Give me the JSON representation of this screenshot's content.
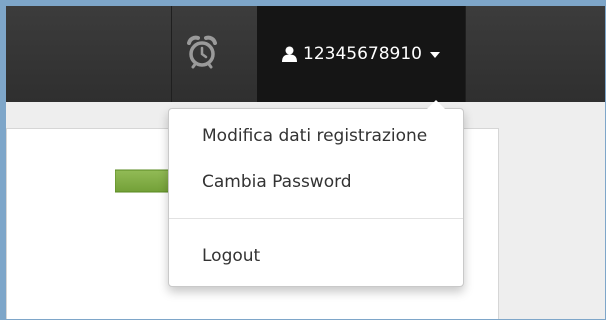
{
  "navbar": {
    "alarm_icon": "alarm-clock-icon",
    "user": {
      "icon": "user-icon",
      "label": "12345678910",
      "caret_icon": "caret-down-icon"
    }
  },
  "dropdown": {
    "items": [
      {
        "label": "Modifica dati registrazione"
      },
      {
        "label": "Cambia Password"
      },
      {
        "label": "Logout"
      }
    ]
  },
  "annotation": {
    "arrow_icon": "arrow-right-icon",
    "arrow_color": "#6a9a2c"
  },
  "colors": {
    "navbar": "#333333",
    "user_menu_active": "#151515",
    "frame_border": "#7ea6c9"
  }
}
